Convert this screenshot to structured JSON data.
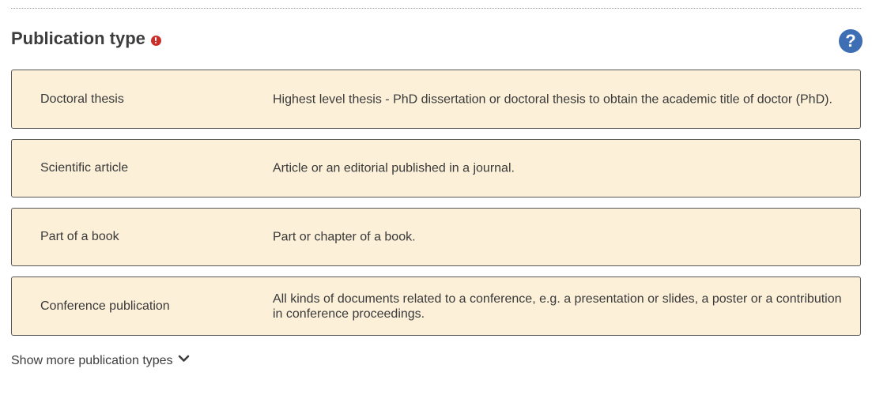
{
  "section": {
    "title": "Publication type",
    "required_icon": "exclamation-circle-icon",
    "help_label": "?",
    "help_icon": "question-circle-icon"
  },
  "types": [
    {
      "name": "Doctoral thesis",
      "description": "Highest level thesis - PhD dissertation or doctoral thesis to obtain the academic title of doctor (PhD)."
    },
    {
      "name": "Scientific article",
      "description": "Article or an editorial published in a journal."
    },
    {
      "name": "Part of a book",
      "description": "Part or chapter of a book."
    },
    {
      "name": "Conference publication",
      "description": "All kinds of documents related to a conference, e.g. a presentation or slides, a poster or a contribution in conference proceedings."
    }
  ],
  "show_more": {
    "label": "Show more publication types",
    "icon": "chevron-down-icon"
  },
  "colors": {
    "option_background": "#fcf0d9",
    "option_border": "#555555",
    "help_icon": "#3e6fb5",
    "required_icon": "#c9302c"
  }
}
